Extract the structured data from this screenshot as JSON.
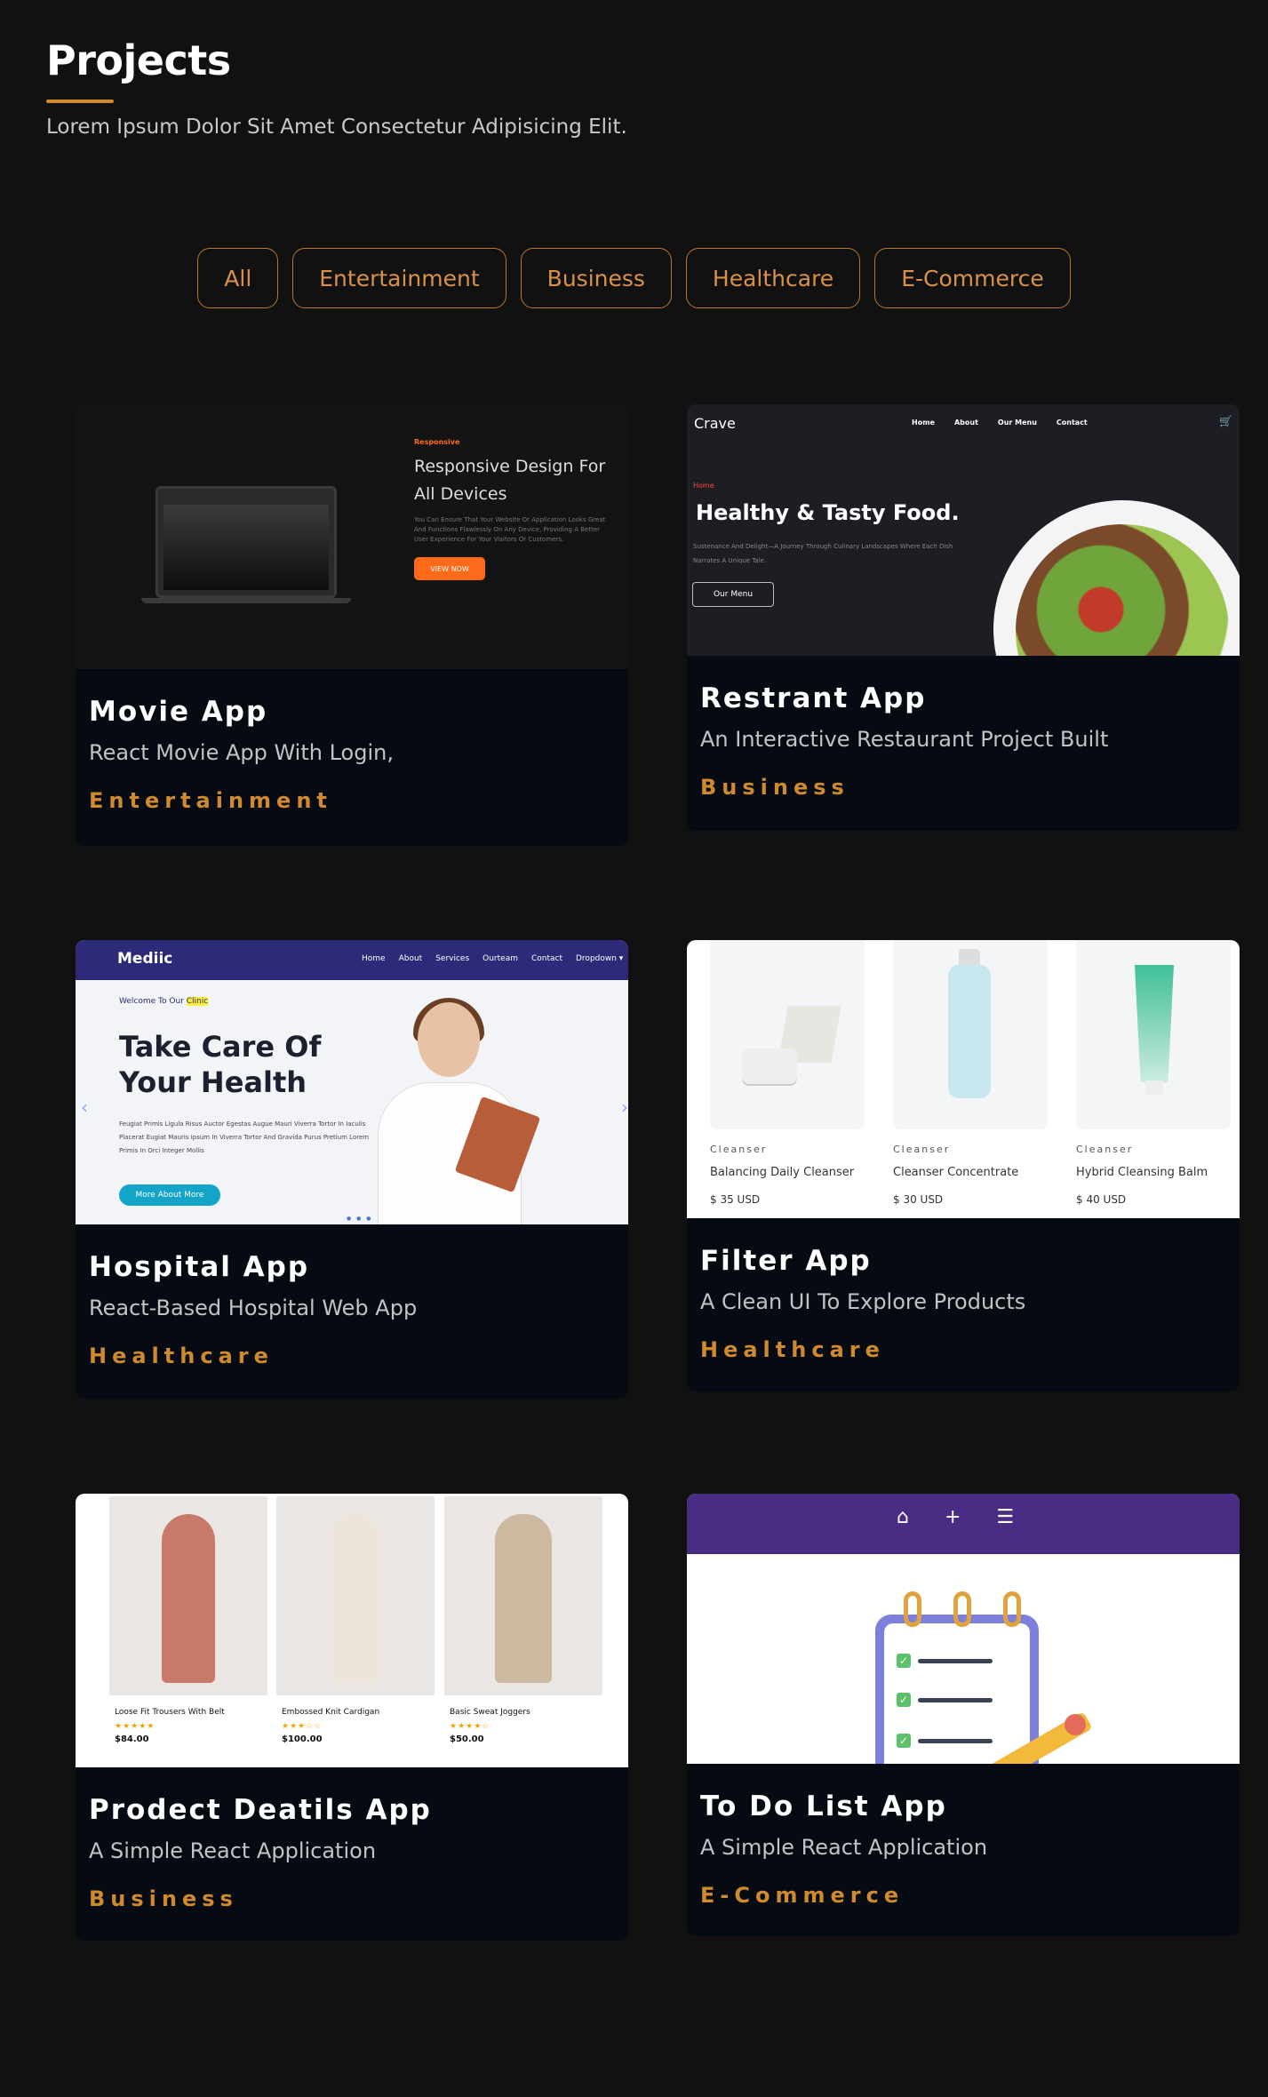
{
  "header": {
    "title": "Projects",
    "subtitle": "Lorem Ipsum Dolor Sit Amet Consectetur Adipisicing Elit."
  },
  "filters": [
    "All",
    "Entertainment",
    "Business",
    "Healthcare",
    "E-Commerce"
  ],
  "cards": [
    {
      "title": "Movie App",
      "description": "React Movie App With Login,",
      "category": "Entertainment"
    },
    {
      "title": "Restrant App",
      "description": "An Interactive Restaurant Project Built",
      "category": "Business"
    },
    {
      "title": "Hospital App",
      "description": "React-Based Hospital Web App",
      "category": "Healthcare"
    },
    {
      "title": "Filter App",
      "description": "A Clean UI To Explore Products",
      "category": "Healthcare"
    },
    {
      "title": "Prodect Deatils App",
      "description": "A Simple React Application",
      "category": "Business"
    },
    {
      "title": "To Do List App",
      "description": "A Simple React Application",
      "category": "E-Commerce"
    }
  ],
  "movie_preview": {
    "tag": "Responsive",
    "heading": "Responsive Design For All Devices",
    "text": "You Can Ensure That Your Website Or Application Looks Great And Functions Flawlessly On Any Device, Providing A Better User Experience For Your Visitors Or Customers.",
    "button": "VIEW NOW"
  },
  "crave_preview": {
    "logo": "Crave",
    "nav": [
      "Home",
      "About",
      "Our Menu",
      "Contact"
    ],
    "tag": "Home",
    "heading": "Healthy & Tasty Food.",
    "text": "Sustenance And Delight—A Journey Through Culinary Landscapes Where Each Dish Narrates A Unique Tale.",
    "button": "Our Menu"
  },
  "hospital_preview": {
    "logo": "Mediic",
    "nav": [
      "Home",
      "About",
      "Services",
      "Ourteam",
      "Contact",
      "Dropdown ▾"
    ],
    "welcome": "Welcome To Our",
    "welcome_highlight": "Clinic",
    "heading": "Take Care Of Your Health",
    "text": "Feugiat Primis Ligula Risus Auctor Egestas Augue Mauri Viverra Tortor In Iaculis Placerat Eugiat Mauris Ipsum In Viverra Tortor And Gravida Purus Pretium Lorem Primis In Orci Integer Mollis",
    "button": "More About More"
  },
  "filter_preview": {
    "products": [
      {
        "category": "Cleanser",
        "name": "Balancing Daily Cleanser",
        "price": "$ 35 USD"
      },
      {
        "category": "Cleanser",
        "name": "Cleanser Concentrate",
        "price": "$ 30 USD"
      },
      {
        "category": "Cleanser",
        "name": "Hybrid Cleansing Balm",
        "price": "$ 40 USD"
      }
    ]
  },
  "product_preview": {
    "items": [
      {
        "name": "Loose Fit Trousers With Belt",
        "stars": "★★★★★",
        "price": "$84.00"
      },
      {
        "name": "Embossed Knit Cardigan",
        "stars": "★★★☆☆",
        "price": "$100.00"
      },
      {
        "name": "Basic Sweat Joggers",
        "stars": "★★★★☆",
        "price": "$50.00"
      }
    ]
  }
}
